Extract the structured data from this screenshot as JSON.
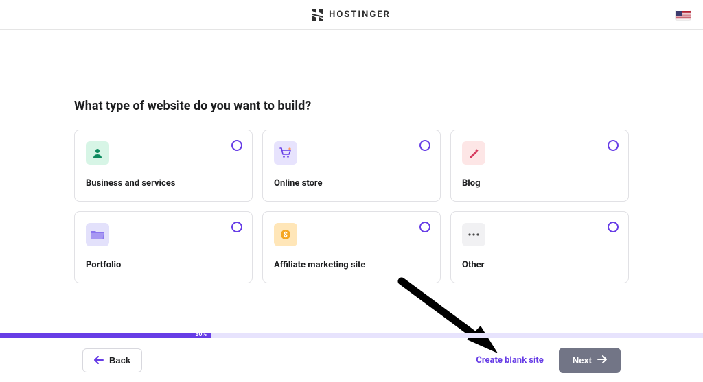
{
  "brand": "HOSTINGER",
  "question": "What type of website do you want to build?",
  "options": [
    {
      "label": "Business and services",
      "icon": "person-icon",
      "swatch": "sw-green"
    },
    {
      "label": "Online store",
      "icon": "cart-icon",
      "swatch": "sw-purple"
    },
    {
      "label": "Blog",
      "icon": "pencil-icon",
      "swatch": "sw-pink"
    },
    {
      "label": "Portfolio",
      "icon": "folder-icon",
      "swatch": "sw-lilac"
    },
    {
      "label": "Affiliate marketing site",
      "icon": "dollar-icon",
      "swatch": "sw-orange"
    },
    {
      "label": "Other",
      "icon": "dots-icon",
      "swatch": "sw-grey"
    }
  ],
  "progress": {
    "percent": 30,
    "label": "30%"
  },
  "footer": {
    "back": "Back",
    "blank": "Create blank site",
    "next": "Next"
  }
}
